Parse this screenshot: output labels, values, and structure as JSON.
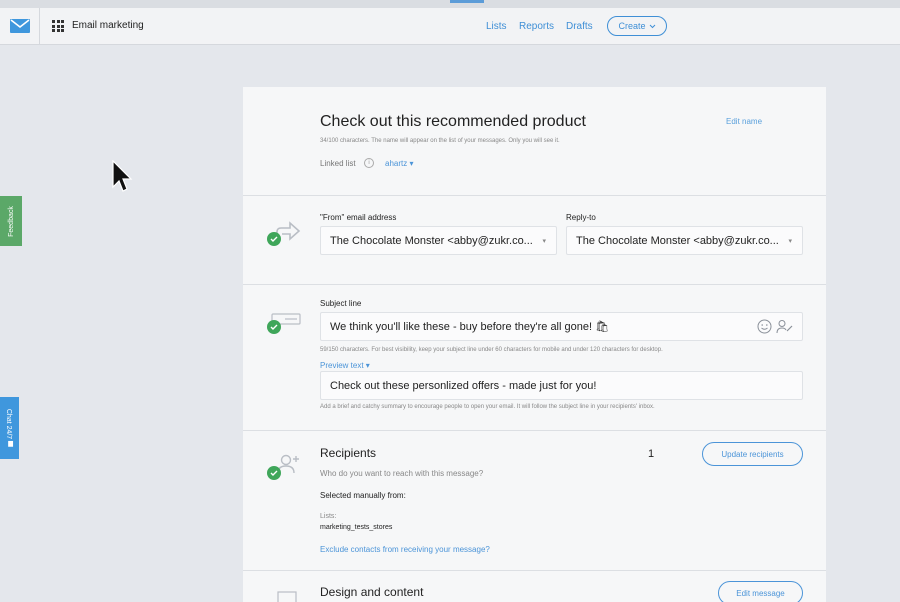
{
  "header": {
    "app_name": "Email marketing",
    "nav": {
      "lists": "Lists",
      "reports": "Reports",
      "drafts": "Drafts"
    },
    "create_label": "Create"
  },
  "side_tabs": {
    "feedback": "Feedback",
    "chat": "Chat 24/7"
  },
  "message": {
    "title": "Check out this recommended product",
    "edit_name": "Edit name",
    "name_hint": "34/100 characters. The name will appear on the list of your messages. Only you will see it.",
    "linked_list_label": "Linked list",
    "linked_list_value": "ahartz"
  },
  "from_section": {
    "from_label": "\"From\" email address",
    "from_value": "The Chocolate Monster <abby@zukr.co...",
    "reply_label": "Reply-to",
    "reply_value": "The Chocolate Monster <abby@zukr.co..."
  },
  "subject_section": {
    "label": "Subject line",
    "value": "We think you'll like these - buy before they're all gone! 🛍",
    "hint": "59/150 characters. For best visibility, keep your subject line under 60 characters for mobile and under 120 characters for desktop.",
    "preview_toggle": "Preview text",
    "preview_value": "Check out these personlized offers - made just for you!",
    "preview_hint": "Add a brief and catchy summary to encourage people to open your email. It will follow the subject line in your recipients' inbox."
  },
  "recipients_section": {
    "title": "Recipients",
    "subtitle": "Who do you want to reach with this message?",
    "count": "1",
    "update_button": "Update recipients",
    "selected_from": "Selected manually from:",
    "lists_label": "Lists:",
    "list_name": "marketing_tests_stores",
    "exclude_link": "Exclude contacts from receiving your message?"
  },
  "design_section": {
    "title": "Design and content",
    "edit_button": "Edit message"
  },
  "colors": {
    "accent": "#3f8fd6",
    "success": "#3fa65a",
    "feedback": "#5ba868",
    "chat": "#3f97dd"
  },
  "icons": [
    "envelope-logo-icon",
    "apps-grid-icon",
    "chevron-down-icon",
    "cursor-arrow-icon",
    "share-arrow-icon",
    "check-icon",
    "subject-card-icon",
    "emoji-icon",
    "personalize-icon",
    "add-person-icon",
    "image-icon",
    "chat-bubble-icon"
  ]
}
